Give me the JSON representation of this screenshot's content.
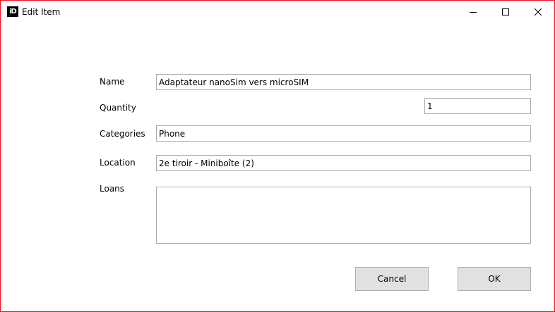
{
  "window": {
    "app_icon_text": "iD",
    "title": "Edit Item"
  },
  "form": {
    "name_label": "Name",
    "name_value": "Adaptateur nanoSim vers microSIM",
    "quantity_label": "Quantity",
    "quantity_value": "1",
    "categories_label": "Categories",
    "categories_value": "Phone",
    "location_label": "Location",
    "location_value": "2e tiroir - Miniboîte (2)",
    "loans_label": "Loans",
    "loans_value": ""
  },
  "buttons": {
    "cancel_label": "Cancel",
    "ok_label": "OK"
  },
  "icons": {
    "app": "app-icon",
    "minimize": "minimize-icon",
    "maximize": "maximize-icon",
    "close": "close-icon"
  },
  "colors": {
    "window_border": "#e81123",
    "button_face": "#e1e1e1"
  }
}
